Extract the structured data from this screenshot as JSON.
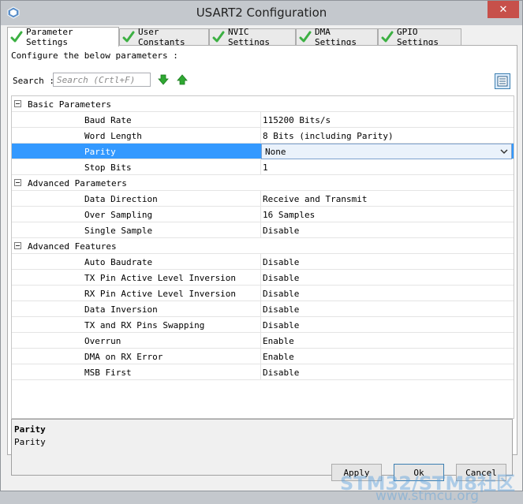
{
  "window": {
    "title": "USART2 Configuration",
    "close_label": "✕"
  },
  "tabs": [
    {
      "label": "Parameter Settings",
      "active": true
    },
    {
      "label": "User Constants",
      "active": false
    },
    {
      "label": "NVIC Settings",
      "active": false
    },
    {
      "label": "DMA Settings",
      "active": false
    },
    {
      "label": "GPIO Settings",
      "active": false
    }
  ],
  "panel": {
    "configure_text": "Configure the below parameters :",
    "search_label": "Search :",
    "search_placeholder": "Search (Crtl+F)"
  },
  "groups": [
    {
      "label": "Basic Parameters",
      "params": [
        {
          "name": "Baud Rate",
          "value": "115200 Bits/s"
        },
        {
          "name": "Word Length",
          "value": "8 Bits (including Parity)"
        },
        {
          "name": "Parity",
          "value": "None"
        },
        {
          "name": "Stop Bits",
          "value": "1"
        }
      ]
    },
    {
      "label": "Advanced Parameters",
      "params": [
        {
          "name": "Data Direction",
          "value": "Receive and Transmit"
        },
        {
          "name": "Over Sampling",
          "value": "16 Samples"
        },
        {
          "name": "Single Sample",
          "value": "Disable"
        }
      ]
    },
    {
      "label": "Advanced Features",
      "params": [
        {
          "name": "Auto Baudrate",
          "value": "Disable"
        },
        {
          "name": "TX Pin Active Level Inversion",
          "value": "Disable"
        },
        {
          "name": "RX Pin Active Level Inversion",
          "value": "Disable"
        },
        {
          "name": "Data Inversion",
          "value": "Disable"
        },
        {
          "name": "TX and RX Pins Swapping",
          "value": "Disable"
        },
        {
          "name": "Overrun",
          "value": "Enable"
        },
        {
          "name": "DMA on RX Error",
          "value": "Enable"
        },
        {
          "name": "MSB First",
          "value": "Disable"
        }
      ]
    }
  ],
  "description": {
    "title": "Parity",
    "body": "Parity"
  },
  "buttons": {
    "apply": "Apply",
    "ok": "Ok",
    "cancel": "Cancel"
  },
  "watermark": {
    "line1": "STM32/STM8社区",
    "line2": "www.stmcu.org"
  },
  "colors": {
    "selection": "#3399ff",
    "close": "#c7504a",
    "check": "#3cb043",
    "arrow": "#2fa832"
  },
  "icons": {
    "tab_status": "check-icon",
    "move_down": "arrow-down-icon",
    "move_up": "arrow-up-icon",
    "view": "list-view-icon",
    "dropdown": "chevron-down-icon"
  }
}
